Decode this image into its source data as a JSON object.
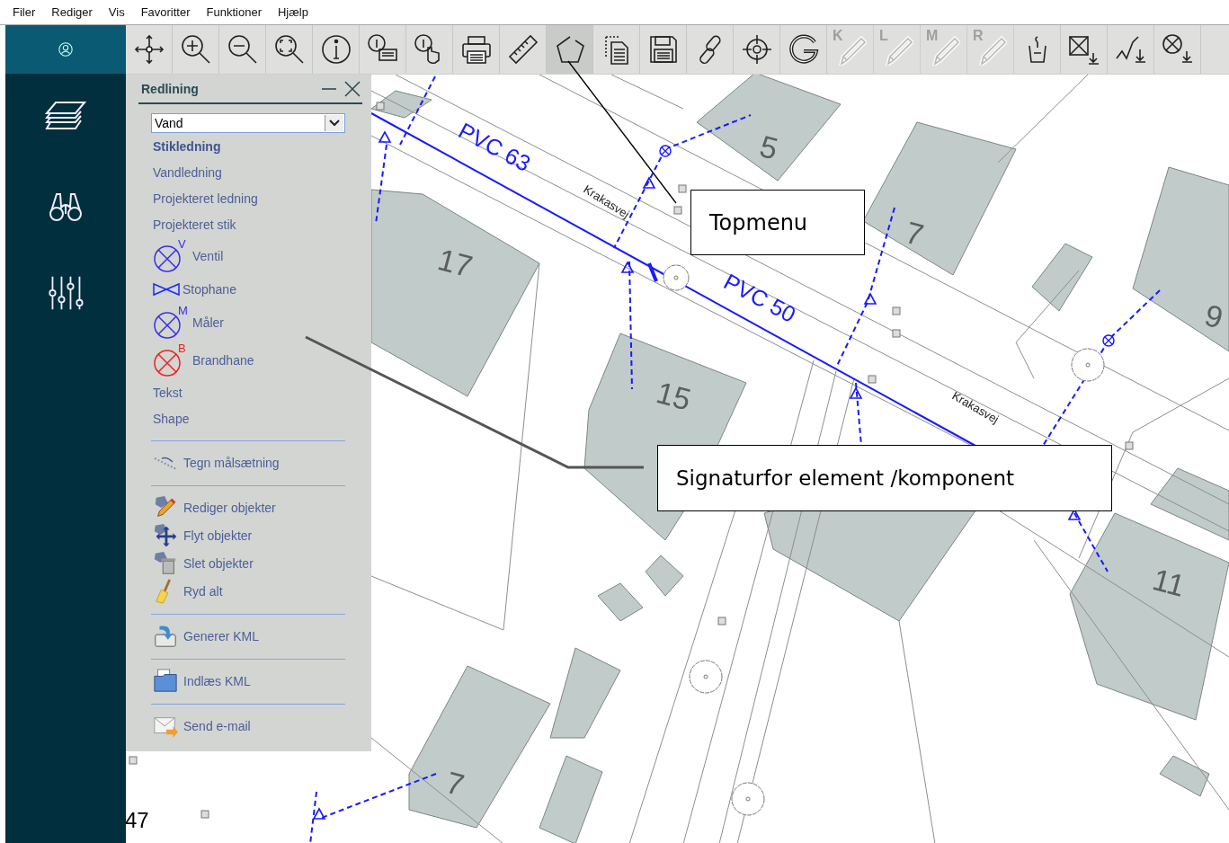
{
  "menu": [
    "Filer",
    "Rediger",
    "Vis",
    "Favoritter",
    "Funktioner",
    "Hjælp"
  ],
  "toolbar": {
    "buttons": [
      {
        "kind": "icon",
        "selected": false,
        "disabled": false
      },
      {
        "kind": "icon",
        "selected": false,
        "disabled": false
      },
      {
        "kind": "icon",
        "selected": false,
        "disabled": false
      },
      {
        "kind": "icon",
        "selected": false,
        "disabled": false
      },
      {
        "kind": "icon",
        "selected": false,
        "disabled": false
      },
      {
        "kind": "icon",
        "selected": false,
        "disabled": false
      },
      {
        "kind": "icon",
        "selected": false,
        "disabled": false
      },
      {
        "kind": "icon",
        "selected": false,
        "disabled": false
      },
      {
        "kind": "icon",
        "selected": false,
        "disabled": false
      },
      {
        "kind": "icon",
        "selected": true,
        "disabled": false
      },
      {
        "kind": "icon",
        "selected": false,
        "disabled": false
      },
      {
        "kind": "icon",
        "selected": false,
        "disabled": false
      },
      {
        "kind": "icon",
        "selected": false,
        "disabled": false
      },
      {
        "kind": "icon",
        "selected": false,
        "disabled": false
      },
      {
        "kind": "icon",
        "selected": false,
        "disabled": false
      },
      {
        "kind": "lettered",
        "letter": "K",
        "selected": false,
        "disabled": true
      },
      {
        "kind": "lettered",
        "letter": "L",
        "selected": false,
        "disabled": true
      },
      {
        "kind": "lettered",
        "letter": "M",
        "selected": false,
        "disabled": true
      },
      {
        "kind": "lettered",
        "letter": "R",
        "selected": false,
        "disabled": true
      },
      {
        "kind": "icon",
        "selected": false,
        "disabled": false
      },
      {
        "kind": "icon",
        "selected": false,
        "disabled": false
      },
      {
        "kind": "icon",
        "selected": false,
        "disabled": false
      },
      {
        "kind": "icon",
        "selected": false,
        "disabled": false
      }
    ]
  },
  "panel": {
    "title": "Redlining",
    "dropdown": {
      "value": "Vand"
    },
    "groups": [
      {
        "items": [
          {
            "kind": "link",
            "label": "Stikledning",
            "selected": true
          },
          {
            "kind": "link",
            "label": "Vandledning",
            "selected": false
          },
          {
            "kind": "link",
            "label": "Projekteret ledning",
            "selected": false
          },
          {
            "kind": "link",
            "label": "Projekteret stik",
            "selected": false
          },
          {
            "kind": "symbol",
            "label": "Ventil",
            "letter": "V",
            "color": "#3b2cf0",
            "selected": false
          },
          {
            "kind": "valve",
            "label": "Stophane",
            "selected": false
          },
          {
            "kind": "symbol",
            "label": "Måler",
            "letter": "M",
            "color": "#3b2cf0",
            "selected": false
          },
          {
            "kind": "symbol",
            "label": "Brandhane",
            "letter": "B",
            "color": "#f02020",
            "selected": false
          },
          {
            "kind": "link",
            "label": "Tekst",
            "selected": false
          },
          {
            "kind": "link",
            "label": "Shape",
            "selected": false
          }
        ]
      },
      {
        "items": [
          {
            "kind": "tool",
            "label": "Tegn målsætning",
            "selected": false
          }
        ]
      },
      {
        "items": [
          {
            "kind": "tool",
            "label": "Rediger objekter",
            "selected": false
          },
          {
            "kind": "tool",
            "label": "Flyt objekter",
            "selected": false
          },
          {
            "kind": "tool",
            "label": "Slet objekter",
            "selected": false
          },
          {
            "kind": "tool",
            "label": "Ryd alt",
            "selected": false
          }
        ]
      },
      {
        "items": [
          {
            "kind": "tool",
            "label": "Generer KML",
            "selected": false
          }
        ]
      },
      {
        "items": [
          {
            "kind": "tool",
            "label": "Indlæs KML",
            "selected": false
          }
        ]
      },
      {
        "items": [
          {
            "kind": "tool",
            "label": "Send e-mail",
            "selected": false
          }
        ]
      }
    ]
  },
  "map": {
    "labels": [
      {
        "kind": "pipe",
        "text": "PVC 63"
      },
      {
        "kind": "street",
        "text": "Krakasvej"
      },
      {
        "kind": "pipe",
        "text": "PVC 50"
      },
      {
        "kind": "street",
        "text": "Krakasvej"
      },
      {
        "kind": "house_number",
        "text": "5"
      },
      {
        "kind": "house_number",
        "text": "7"
      },
      {
        "kind": "house_number",
        "text": "17"
      },
      {
        "kind": "house_number",
        "text": "15"
      },
      {
        "kind": "house_number",
        "text": "9"
      },
      {
        "kind": "house_number",
        "text": "11"
      },
      {
        "kind": "house_number",
        "text": "7"
      },
      {
        "kind": "edge_number",
        "text": "47"
      }
    ]
  },
  "callouts": [
    {
      "text": "Topmenu"
    },
    {
      "text": "Signaturfor element /komponent"
    }
  ]
}
